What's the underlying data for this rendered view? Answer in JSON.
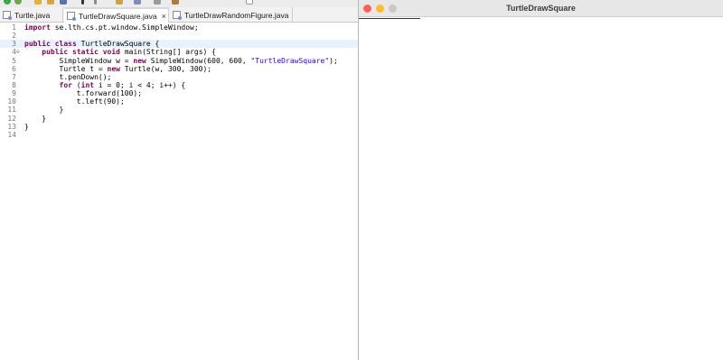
{
  "editor": {
    "tabs": [
      {
        "label": "Turtle.java",
        "active": false,
        "closable": false
      },
      {
        "label": "TurtleDrawSquare.java",
        "active": true,
        "closable": true
      },
      {
        "label": "TurtleDrawRandomFigure.java",
        "active": false,
        "closable": false
      }
    ],
    "close_glyph": "×",
    "fold_glyph": "⊖",
    "code_lines": [
      {
        "n": "1",
        "code": "import se.lth.cs.pt.window.SimpleWindow;"
      },
      {
        "n": "2",
        "code": ""
      },
      {
        "n": "3",
        "code": "public class TurtleDrawSquare {"
      },
      {
        "n": "4",
        "code": "    public static void main(String[] args) {"
      },
      {
        "n": "5",
        "code": "        SimpleWindow w = new SimpleWindow(600, 600, \"TurtleDrawSquare\");"
      },
      {
        "n": "6",
        "code": "        Turtle t = new Turtle(w, 300, 300);"
      },
      {
        "n": "7",
        "code": "        t.penDown();"
      },
      {
        "n": "8",
        "code": "        for (int i = 0; i < 4; i++) {"
      },
      {
        "n": "9",
        "code": "            t.forward(100);"
      },
      {
        "n": "10",
        "code": "            t.left(90);"
      },
      {
        "n": "11",
        "code": "        }"
      },
      {
        "n": "12",
        "code": "    }"
      },
      {
        "n": "13",
        "code": "}"
      },
      {
        "n": "14",
        "code": ""
      }
    ],
    "highlighted_line": "3",
    "folded_line": "4",
    "colors": {
      "keyword": "#7f0055",
      "string": "#2a00ff",
      "line_highlight": "#e8f2fe"
    }
  },
  "window": {
    "title": "TurtleDrawSquare",
    "traffic_lights": [
      {
        "name": "close",
        "color": "#fe5f57"
      },
      {
        "name": "minimize",
        "color": "#febc2e"
      },
      {
        "name": "zoom",
        "color": "#c8c8c8"
      }
    ]
  }
}
